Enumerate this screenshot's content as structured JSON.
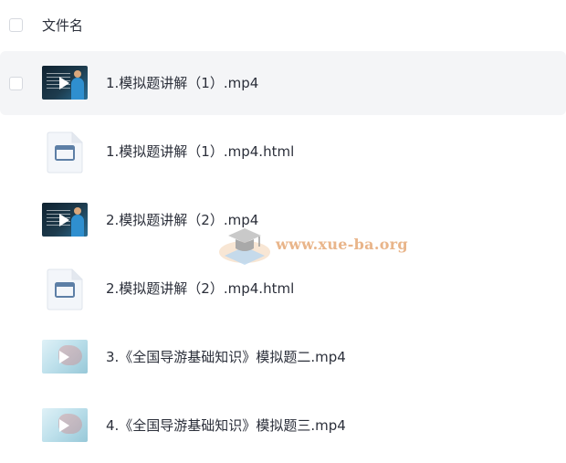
{
  "header": {
    "column_label": "文件名"
  },
  "files": [
    {
      "name": "1.模拟题讲解（1）.mp4",
      "type": "video",
      "thumb_icon": "video-thumbnail-lecture-icon",
      "highlighted": true
    },
    {
      "name": "1.模拟题讲解（1）.mp4.html",
      "type": "html",
      "thumb_icon": "html-file-icon"
    },
    {
      "name": "2.模拟题讲解（2）.mp4",
      "type": "video",
      "thumb_icon": "video-thumbnail-lecture-icon"
    },
    {
      "name": "2.模拟题讲解（2）.mp4.html",
      "type": "html",
      "thumb_icon": "html-file-icon"
    },
    {
      "name": "3.《全国导游基础知识》模拟题二.mp4",
      "type": "video",
      "thumb_icon": "video-thumbnail-map-icon"
    },
    {
      "name": "4.《全国导游基础知识》模拟题三.mp4",
      "type": "video",
      "thumb_icon": "video-thumbnail-map-icon"
    }
  ],
  "watermark": {
    "text": "www.xue-ba.org",
    "logo_icon": "graduation-cap-logo"
  },
  "colors": {
    "text": "#2b2f3a",
    "row_highlight": "#f4f5f7",
    "checkbox_border": "#d6d9df",
    "html_icon_blue": "#5d7fa6",
    "watermark": "#e9b58a"
  }
}
